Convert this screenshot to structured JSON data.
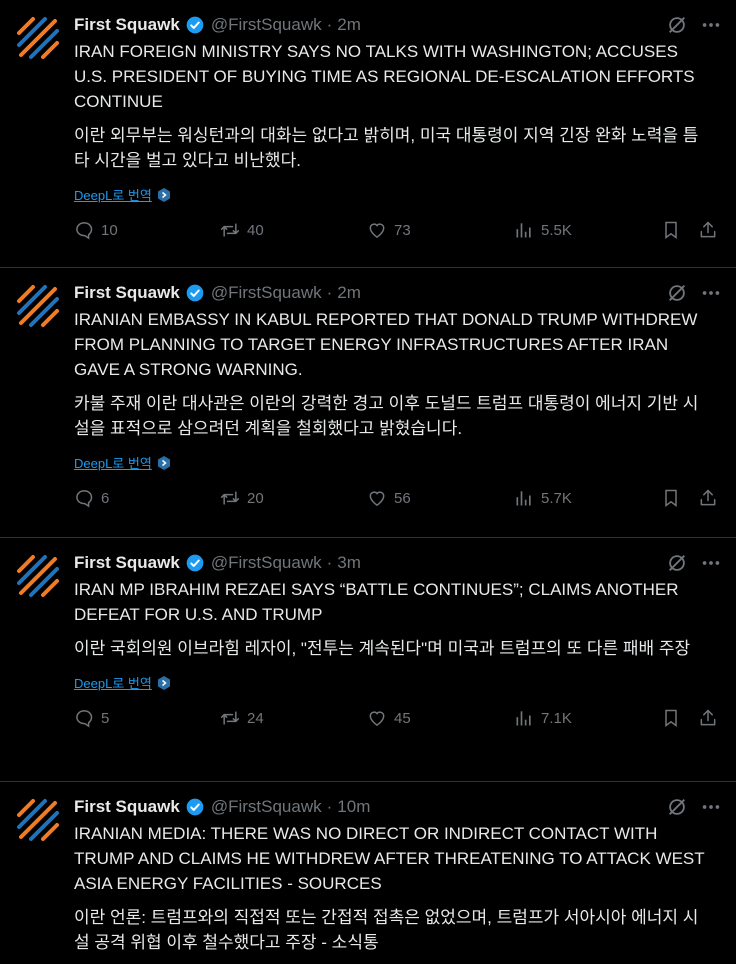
{
  "tweets": [
    {
      "author": "First Squawk",
      "handle": "@FirstSquawk",
      "separator": "·",
      "time": "2m",
      "text_en": "IRAN FOREIGN MINISTRY SAYS NO TALKS WITH WASHINGTON; ACCUSES U.S. PRESIDENT OF BUYING TIME AS REGIONAL DE-ESCALATION EFFORTS CONTINUE",
      "text_ko": "이란 외무부는 워싱턴과의 대화는 없다고 밝히며, 미국 대통령이 지역 긴장 완화 노력을 틈타 시간을 벌고 있다고 비난했다.",
      "translate_label": "DeepL로 번역",
      "replies": "10",
      "retweets": "40",
      "likes": "73",
      "views": "5.5K"
    },
    {
      "author": "First Squawk",
      "handle": "@FirstSquawk",
      "separator": "·",
      "time": "2m",
      "text_en": "IRANIAN EMBASSY IN KABUL REPORTED THAT DONALD TRUMP WITHDREW FROM PLANNING TO TARGET ENERGY INFRASTRUCTURES AFTER IRAN GAVE A STRONG WARNING.",
      "text_ko": "카불 주재 이란 대사관은 이란의 강력한 경고 이후 도널드 트럼프 대통령이 에너지 기반 시설을 표적으로 삼으려던 계획을 철회했다고 밝혔습니다.",
      "translate_label": "DeepL로 번역",
      "replies": "6",
      "retweets": "20",
      "likes": "56",
      "views": "5.7K"
    },
    {
      "author": "First Squawk",
      "handle": "@FirstSquawk",
      "separator": "·",
      "time": "3m",
      "text_en": "IRAN MP IBRAHIM REZAEI SAYS “BATTLE CONTINUES”; CLAIMS ANOTHER DEFEAT FOR U.S. AND TRUMP",
      "text_ko": "이란 국회의원 이브라힘 레자이, \"전투는 계속된다\"며 미국과 트럼프의 또 다른 패배 주장",
      "translate_label": "DeepL로 번역",
      "replies": "5",
      "retweets": "24",
      "likes": "45",
      "views": "7.1K"
    },
    {
      "author": "First Squawk",
      "handle": "@FirstSquawk",
      "separator": "·",
      "time": "10m",
      "text_en": "IRANIAN MEDIA: THERE WAS NO DIRECT OR INDIRECT CONTACT WITH TRUMP AND CLAIMS HE WITHDREW AFTER THREATENING TO ATTACK WEST ASIA ENERGY FACILITIES - SOURCES",
      "text_ko": "이란 언론: 트럼프와의 직접적 또는 간접적 접촉은 없었으며, 트럼프가 서아시아 에너지 시설 공격 위협 이후 철수했다고 주장 - 소식통",
      "translate_label": "",
      "replies": "",
      "retweets": "",
      "likes": "",
      "views": ""
    }
  ],
  "colors": {
    "background": "#000000",
    "text": "#e7e9ea",
    "muted": "#71767b",
    "link": "#1d9bf0",
    "verified": "#1d9bf0",
    "logo_orange": "#f47b20",
    "logo_blue": "#1e73be",
    "divider": "#2f3336"
  },
  "icons": [
    "first-squawk-logo",
    "verified-badge-icon",
    "grok-icon",
    "more-icon",
    "deepl-icon",
    "reply-icon",
    "retweet-icon",
    "like-icon",
    "views-icon",
    "bookmark-icon",
    "share-icon"
  ]
}
